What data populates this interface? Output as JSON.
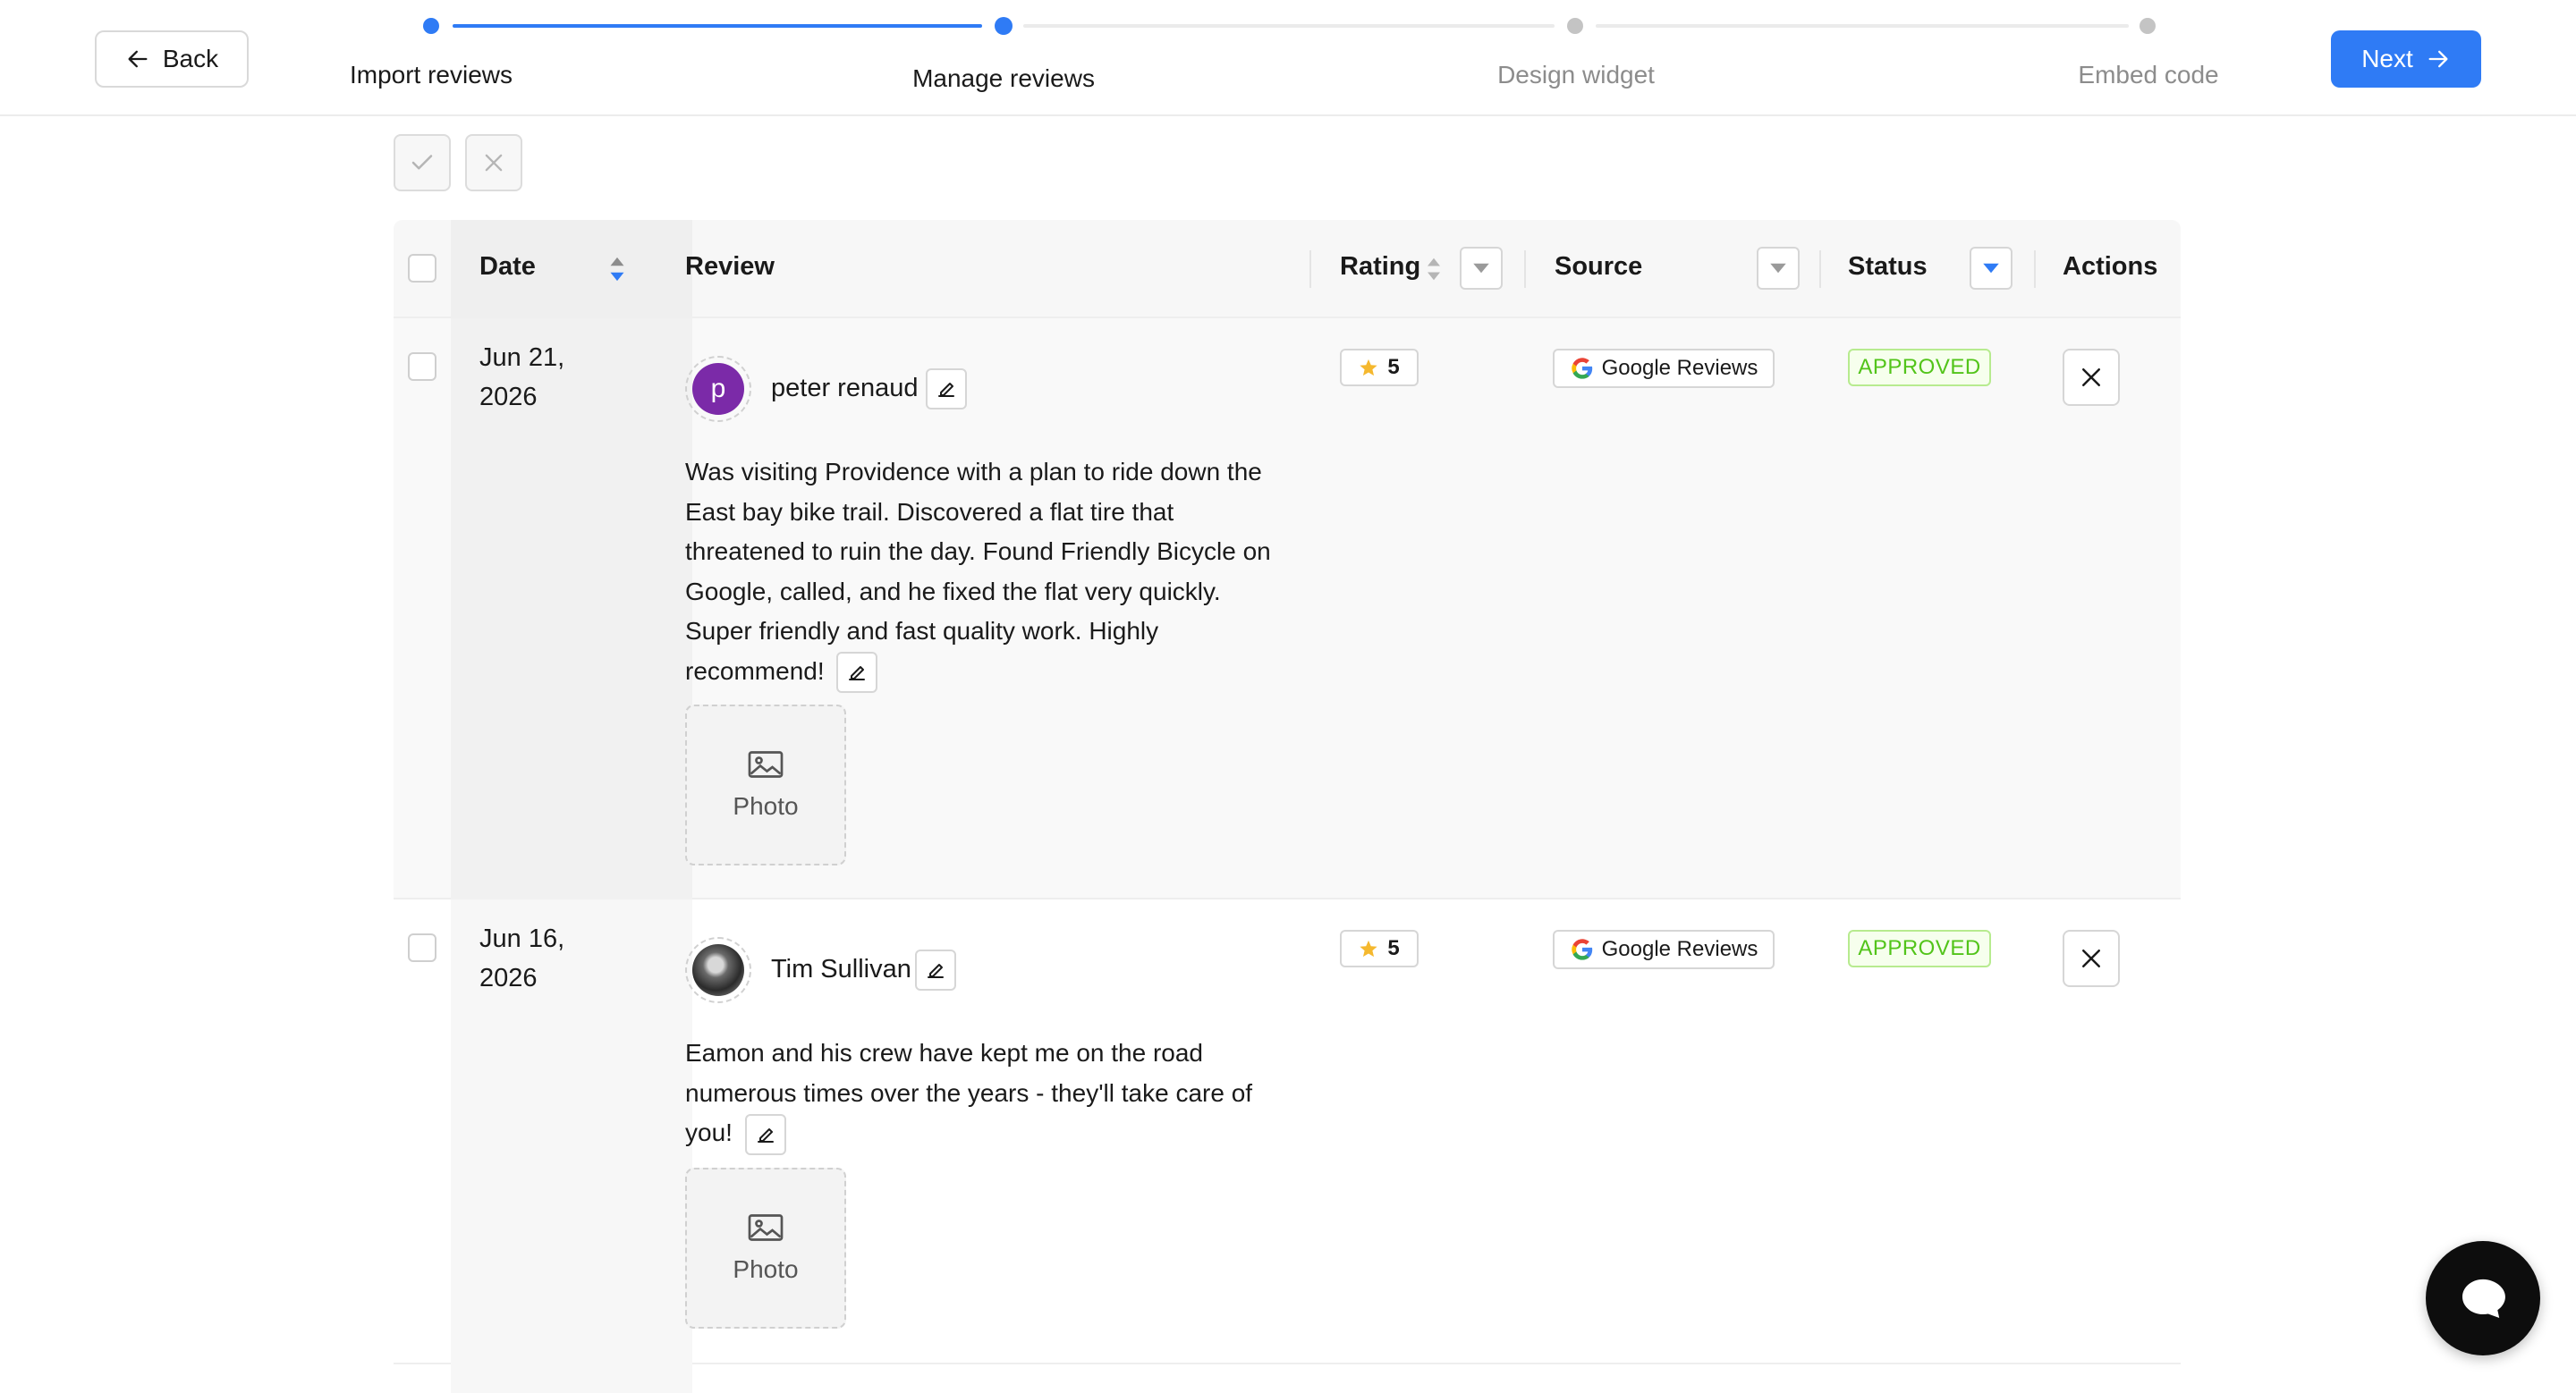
{
  "header": {
    "back_label": "Back",
    "next_label": "Next",
    "steps": [
      {
        "label": "Import reviews",
        "state": "done"
      },
      {
        "label": "Manage reviews",
        "state": "active"
      },
      {
        "label": "Design widget",
        "state": "pending"
      },
      {
        "label": "Embed code",
        "state": "pending"
      }
    ]
  },
  "toolbar": {
    "approve_icon": "check-icon",
    "reject_icon": "close-icon"
  },
  "table": {
    "columns": {
      "date": "Date",
      "review": "Review",
      "rating": "Rating",
      "source": "Source",
      "status": "Status",
      "actions": "Actions"
    },
    "rows": [
      {
        "date_line1": "Jun 21,",
        "date_line2": "2026",
        "author": "peter renaud",
        "avatar_initial": "p",
        "review": "Was visiting Providence with a plan to ride down the East bay bike trail. Discovered a flat tire that threatened to ruin the day. Found Friendly Bicycle on Google, called, and he fixed the flat very quickly. Super friendly and fast quality work.  Highly recommend!",
        "photo_label": "Photo",
        "rating": "5",
        "source": "Google Reviews",
        "status": "APPROVED"
      },
      {
        "date_line1": "Jun 16,",
        "date_line2": "2026",
        "author": "Tim Sullivan",
        "review": "Eamon and his crew have kept me on the road numerous times over the years - they'll take care of you!",
        "photo_label": "Photo",
        "rating": "5",
        "source": "Google Reviews",
        "status": "APPROVED"
      }
    ]
  },
  "colors": {
    "primary": "#2f7bf5",
    "approved_text": "#52c41a",
    "approved_bg": "#f6ffed",
    "approved_border": "#b7eb8f",
    "avatar_purple": "#7b2aa8",
    "star": "#f5b82e"
  }
}
